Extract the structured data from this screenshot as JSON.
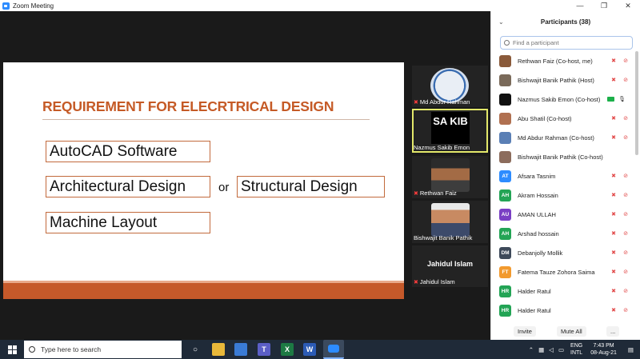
{
  "window": {
    "title": "Zoom Meeting",
    "controls": [
      "—",
      "❐",
      "✕"
    ]
  },
  "slide": {
    "title": "REQUIREMENT FOR ELECRTRICAL DESIGN",
    "boxes": {
      "autocad": "AutoCAD Software",
      "architectural": "Architectural Design",
      "structural": "Structural Design",
      "machine": "Machine Layout"
    },
    "or_text": "or",
    "accent_color": "#c55a26"
  },
  "video_tiles": [
    {
      "name": "Md Abdur Rahman",
      "muted": true
    },
    {
      "name": "Nazmus Sakib Emon",
      "muted": false,
      "active": true,
      "logo_text": "SA KIB"
    },
    {
      "name": "Rethwan Faiz",
      "muted": true
    },
    {
      "name": "Bishwajit Banik Pathik",
      "muted": false
    },
    {
      "name": "Jahidul Islam",
      "big_name": "Jahidul Islam",
      "muted": true
    }
  ],
  "participants": {
    "title": "Participants (38)",
    "search_placeholder": "Find a participant",
    "rows": [
      {
        "name": "Rethwan Faiz (Co-host, me)",
        "initials": "",
        "color": "#8a5a3a",
        "muted": true,
        "video_off": true
      },
      {
        "name": "Bishwajit Banik Pathik (Host)",
        "initials": "",
        "color": "#7a6a5a",
        "muted": true,
        "video_off": true
      },
      {
        "name": "Nazmus Sakib Emon (Co-host)",
        "initials": "",
        "color": "#111111",
        "muted": false,
        "video_off": false,
        "sharing": true
      },
      {
        "name": "Abu Shatil (Co-host)",
        "initials": "",
        "color": "#b07050",
        "muted": true,
        "video_off": true
      },
      {
        "name": "Md Abdur Rahman (Co-host)",
        "initials": "",
        "color": "#5a7fb5",
        "muted": true,
        "video_off": true
      },
      {
        "name": "Bishwajit Banik Pathik (Co-host)",
        "initials": "",
        "color": "#8c6c5c",
        "muted": false,
        "video_off": false
      },
      {
        "name": "Afsara Tasnim",
        "initials": "AT",
        "color": "#2d8cff",
        "muted": true,
        "video_off": true
      },
      {
        "name": "Akram Hossain",
        "initials": "AH",
        "color": "#23a455",
        "muted": true,
        "video_off": true
      },
      {
        "name": "AMAN ULLAH",
        "initials": "AU",
        "color": "#7a3fc4",
        "muted": true,
        "video_off": true
      },
      {
        "name": "Arshad hossain",
        "initials": "AH",
        "color": "#23a455",
        "muted": true,
        "video_off": true
      },
      {
        "name": "Debanjolly Mollik",
        "initials": "DM",
        "color": "#3e4a5a",
        "muted": true,
        "video_off": true
      },
      {
        "name": "Fatema Tauze Zohora Saima",
        "initials": "FT",
        "color": "#f29a2e",
        "muted": true,
        "video_off": true
      },
      {
        "name": "Halder Ratul",
        "initials": "HR",
        "color": "#23a455",
        "muted": true,
        "video_off": true
      },
      {
        "name": "Halder Ratul",
        "initials": "HR",
        "color": "#23a455",
        "muted": true,
        "video_off": true
      }
    ],
    "footer": {
      "invite": "Invite",
      "mute_all": "Mute All",
      "more": "..."
    }
  },
  "taskbar": {
    "search_placeholder": "Type here to search",
    "lang_line1": "ENG",
    "lang_line2": "INTL",
    "time": "7:43 PM",
    "date": "08-Aug-21",
    "apps": [
      "task-view",
      "file-explorer",
      "store",
      "teams",
      "excel",
      "word",
      "zoom"
    ]
  }
}
